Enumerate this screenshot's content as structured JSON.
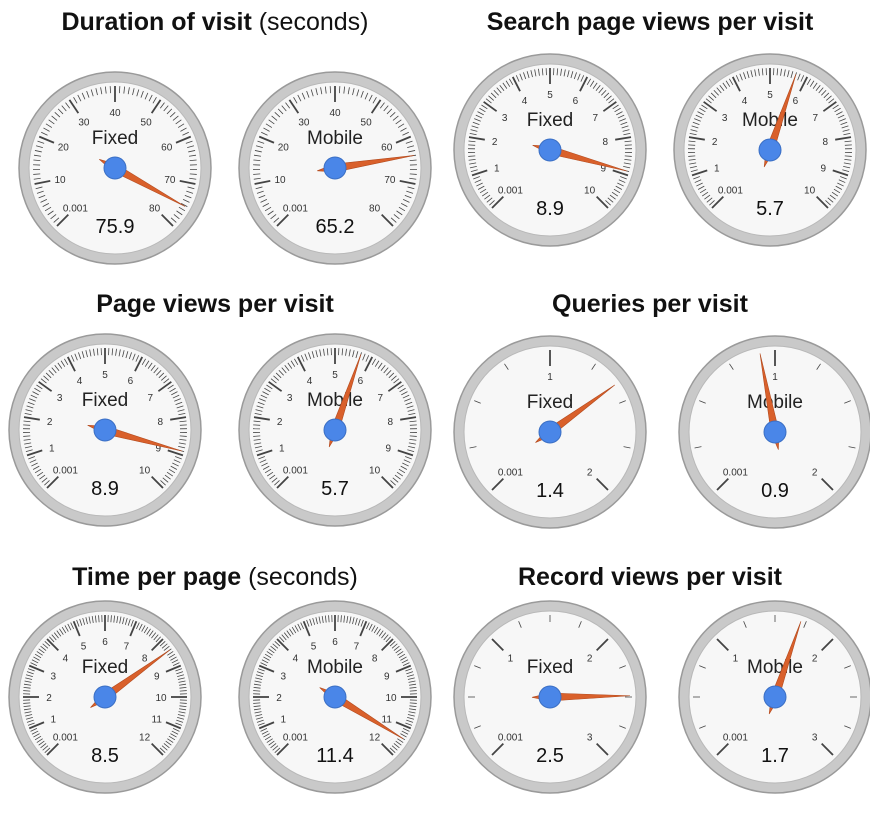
{
  "chart_data": [
    {
      "type": "gauge",
      "title": "Duration of visit",
      "title_suffix": "(seconds)",
      "scale_labels": [
        "0.001",
        "10",
        "20",
        "30",
        "40",
        "50",
        "60",
        "70",
        "80"
      ],
      "gauges": [
        {
          "label": "Fixed",
          "value_text": "75.9",
          "needle_fraction": 0.94
        },
        {
          "label": "Mobile",
          "value_text": "65.2",
          "needle_fraction": 0.8
        }
      ]
    },
    {
      "type": "gauge",
      "title": "Search page views per visit",
      "title_suffix": "",
      "scale_labels": [
        "0.001",
        "1",
        "2",
        "3",
        "4",
        "5",
        "6",
        "7",
        "8",
        "9",
        "10"
      ],
      "gauges": [
        {
          "label": "Fixed",
          "value_text": "8.9",
          "needle_fraction": 0.89
        },
        {
          "label": "Mobile",
          "value_text": "5.7",
          "needle_fraction": 0.57
        }
      ]
    },
    {
      "type": "gauge",
      "title": "Page views per visit",
      "title_suffix": "",
      "scale_labels": [
        "0.001",
        "1",
        "2",
        "3",
        "4",
        "5",
        "6",
        "7",
        "8",
        "9",
        "10"
      ],
      "gauges": [
        {
          "label": "Fixed",
          "value_text": "8.9",
          "needle_fraction": 0.89
        },
        {
          "label": "Mobile",
          "value_text": "5.7",
          "needle_fraction": 0.57
        }
      ]
    },
    {
      "type": "gauge",
      "title": "Queries per visit",
      "title_suffix": "",
      "scale_labels": [
        "0.001",
        "1",
        "2"
      ],
      "gauges": [
        {
          "label": "Fixed",
          "value_text": "1.4",
          "needle_fraction": 0.7
        },
        {
          "label": "Mobile",
          "value_text": "0.9",
          "needle_fraction": 0.46
        }
      ]
    },
    {
      "type": "gauge",
      "title": "Time per page",
      "title_suffix": "(seconds)",
      "scale_labels": [
        "0.001",
        "1",
        "2",
        "3",
        "4",
        "5",
        "6",
        "7",
        "8",
        "9",
        "10",
        "11",
        "12"
      ],
      "gauges": [
        {
          "label": "Fixed",
          "value_text": "8.5",
          "needle_fraction": 0.7
        },
        {
          "label": "Mobile",
          "value_text": "11.4",
          "needle_fraction": 0.95
        }
      ]
    },
    {
      "type": "gauge",
      "title": "Record views per visit",
      "title_suffix": "",
      "scale_labels": [
        "0.001",
        "1",
        "2",
        "3"
      ],
      "gauges": [
        {
          "label": "Fixed",
          "value_text": "2.5",
          "needle_fraction": 0.83
        },
        {
          "label": "Mobile",
          "value_text": "1.7",
          "needle_fraction": 0.57
        }
      ]
    }
  ],
  "colors": {
    "needle": "#d9602b",
    "hub": "#4a86e8",
    "face": "#f7f7f7",
    "bezel": "#c9c9c9",
    "ticks": "#444444"
  }
}
